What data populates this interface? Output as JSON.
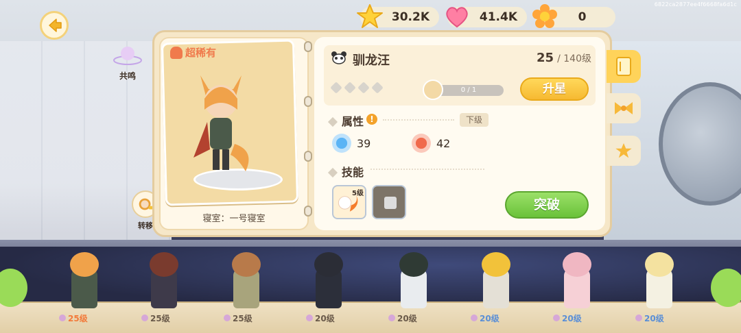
{
  "watermark": "6822ca2877ee4f6668fa6d1c",
  "resources": {
    "stars": "30.2K",
    "hearts": "41.4K",
    "flowers": "0"
  },
  "left": {
    "resonance_label": "共鸣",
    "transfer_label": "转移"
  },
  "card": {
    "rarity": "超稀有",
    "dorm": "寝室：一号寝室"
  },
  "hero": {
    "name": "驯龙汪",
    "level": "25",
    "level_max": "/ 140级",
    "shard_progress": "0 / 1",
    "upgrade_star_label": "升星"
  },
  "attributes": {
    "title": "属性",
    "next_level_label": "下级",
    "stat1": "39",
    "stat2": "42"
  },
  "skills": {
    "title": "技能",
    "skill1_level": "5级"
  },
  "breakthrough_label": "突破",
  "roster": [
    {
      "level": "25级"
    },
    {
      "level": "25级"
    },
    {
      "level": "25级"
    },
    {
      "level": "20级"
    },
    {
      "level": "20级"
    },
    {
      "level": "20级"
    },
    {
      "level": "20级"
    },
    {
      "level": "20级"
    }
  ],
  "colors": {
    "accent_orange": "#f07a4c",
    "upgrade_yellow": "#f6b932",
    "break_green": "#6ac23a",
    "panel": "#f6e7c8"
  }
}
